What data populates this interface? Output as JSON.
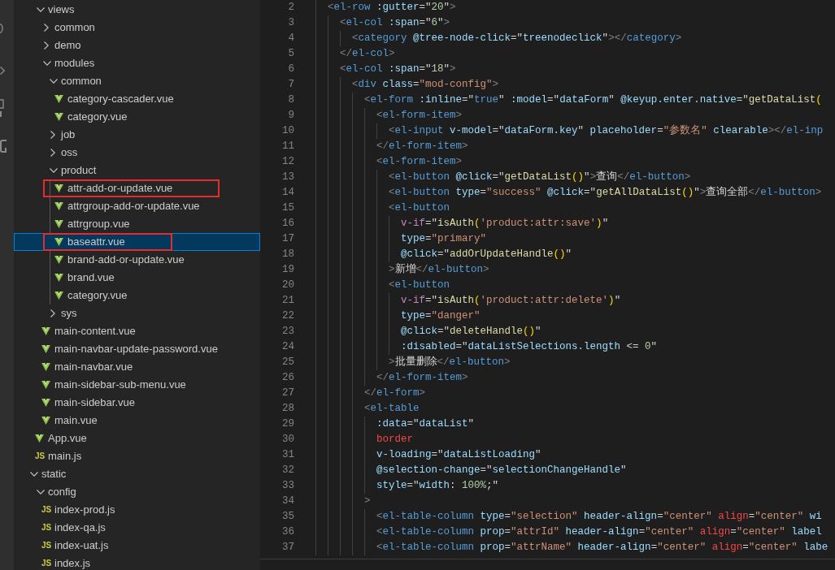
{
  "explorer": {
    "nodes": [
      {
        "children": [
          {
            "label": "views",
            "kind": "folder",
            "expanded": true,
            "selected": false,
            "children": [
              {
                "label": "common",
                "kind": "folder",
                "expanded": false,
                "selected": false
              },
              {
                "label": "demo",
                "kind": "folder",
                "expanded": false,
                "selected": false
              },
              {
                "label": "modules",
                "kind": "folder",
                "expanded": true,
                "selected": false,
                "children": [
                  {
                    "label": "common",
                    "kind": "folder",
                    "expanded": true,
                    "selected": false,
                    "children": [
                      {
                        "label": "category-cascader.vue",
                        "kind": "vue",
                        "selected": false
                      },
                      {
                        "label": "category.vue",
                        "kind": "vue",
                        "selected": false
                      }
                    ]
                  },
                  {
                    "label": "job",
                    "kind": "folder",
                    "expanded": false,
                    "selected": false
                  },
                  {
                    "label": "oss",
                    "kind": "folder",
                    "expanded": false,
                    "selected": false
                  },
                  {
                    "label": "product",
                    "kind": "folder",
                    "expanded": true,
                    "selected": false,
                    "children": [
                      {
                        "label": "attr-add-or-update.vue",
                        "kind": "vue",
                        "selected": false,
                        "annotated": true
                      },
                      {
                        "label": "attrgroup-add-or-update.vue",
                        "kind": "vue",
                        "selected": false,
                        "annotated": false
                      },
                      {
                        "label": "attrgroup.vue",
                        "kind": "vue",
                        "selected": false,
                        "annotated": false
                      },
                      {
                        "label": "baseattr.vue",
                        "kind": "vue",
                        "selected": true,
                        "annotated": true
                      },
                      {
                        "label": "brand-add-or-update.vue",
                        "kind": "vue",
                        "selected": false,
                        "annotated": false
                      },
                      {
                        "label": "brand.vue",
                        "kind": "vue",
                        "selected": false,
                        "annotated": false
                      },
                      {
                        "label": "category.vue",
                        "kind": "vue",
                        "selected": false,
                        "annotated": false
                      }
                    ]
                  },
                  {
                    "label": "sys",
                    "kind": "folder",
                    "expanded": false,
                    "selected": false
                  }
                ]
              },
              {
                "label": "main-content.vue",
                "kind": "vue",
                "selected": false
              },
              {
                "label": "main-navbar-update-password.vue",
                "kind": "vue",
                "selected": false
              },
              {
                "label": "main-navbar.vue",
                "kind": "vue",
                "selected": false
              },
              {
                "label": "main-sidebar-sub-menu.vue",
                "kind": "vue",
                "selected": false
              },
              {
                "label": "main-sidebar.vue",
                "kind": "vue",
                "selected": false
              },
              {
                "label": "main.vue",
                "kind": "vue",
                "selected": false
              }
            ]
          },
          {
            "label": "App.vue",
            "kind": "vue",
            "selected": false
          },
          {
            "label": "main.js",
            "kind": "js",
            "icon_text": "JS",
            "selected": false
          }
        ]
      },
      {
        "label": "static",
        "kind": "folder",
        "expanded": true,
        "selected": false,
        "children": [
          {
            "label": "config",
            "kind": "folder",
            "expanded": true,
            "selected": false,
            "children": [
              {
                "label": "index-prod.js",
                "kind": "js",
                "icon_text": "JS",
                "selected": false
              },
              {
                "label": "index-qa.js",
                "kind": "js",
                "icon_text": "JS",
                "selected": false
              },
              {
                "label": "index-uat.js",
                "kind": "js",
                "icon_text": "JS",
                "selected": false
              },
              {
                "label": "index.js",
                "kind": "js",
                "icon_text": "JS",
                "selected": false
              }
            ]
          }
        ]
      }
    ]
  },
  "editor": {
    "lines": [
      {
        "number": "2",
        "tokens": [
          {
            "text": "  <",
            "kind": "bracket"
          },
          {
            "text": "el-row",
            "kind": "tag"
          },
          {
            "text": " :gutter",
            "kind": "attr"
          },
          {
            "text": "=\"",
            "kind": "plain"
          },
          {
            "text": "20",
            "kind": "number"
          },
          {
            "text": "\"",
            "kind": "plain"
          },
          {
            "text": ">",
            "kind": "bracket"
          }
        ]
      },
      {
        "number": "3",
        "tokens": [
          {
            "text": "    <",
            "kind": "bracket"
          },
          {
            "text": "el-col",
            "kind": "tag"
          },
          {
            "text": " :span",
            "kind": "attr"
          },
          {
            "text": "=\"",
            "kind": "plain"
          },
          {
            "text": "6",
            "kind": "number"
          },
          {
            "text": "\"",
            "kind": "plain"
          },
          {
            "text": ">",
            "kind": "bracket"
          }
        ]
      },
      {
        "number": "4",
        "tokens": [
          {
            "text": "      <",
            "kind": "bracket"
          },
          {
            "text": "category",
            "kind": "tag"
          },
          {
            "text": " @tree-node-click",
            "kind": "attr"
          },
          {
            "text": "=\"",
            "kind": "plain"
          },
          {
            "text": "treenodeclick",
            "kind": "attr"
          },
          {
            "text": "\"",
            "kind": "plain"
          },
          {
            "text": "></",
            "kind": "bracket"
          },
          {
            "text": "category",
            "kind": "tag"
          },
          {
            "text": ">",
            "kind": "bracket"
          }
        ]
      },
      {
        "number": "5",
        "tokens": [
          {
            "text": "    </",
            "kind": "bracket"
          },
          {
            "text": "el-col",
            "kind": "tag"
          },
          {
            "text": ">",
            "kind": "bracket"
          }
        ]
      },
      {
        "number": "6",
        "tokens": [
          {
            "text": "    <",
            "kind": "bracket"
          },
          {
            "text": "el-col",
            "kind": "tag"
          },
          {
            "text": " :span",
            "kind": "attr"
          },
          {
            "text": "=\"",
            "kind": "plain"
          },
          {
            "text": "18",
            "kind": "number"
          },
          {
            "text": "\"",
            "kind": "plain"
          },
          {
            "text": ">",
            "kind": "bracket"
          }
        ]
      },
      {
        "number": "7",
        "tokens": [
          {
            "text": "      <",
            "kind": "bracket"
          },
          {
            "text": "div",
            "kind": "tag"
          },
          {
            "text": " class",
            "kind": "attr"
          },
          {
            "text": "=",
            "kind": "plain"
          },
          {
            "text": "\"mod-config\"",
            "kind": "string"
          },
          {
            "text": ">",
            "kind": "bracket"
          }
        ]
      },
      {
        "number": "8",
        "tokens": [
          {
            "text": "        <",
            "kind": "bracket"
          },
          {
            "text": "el-form",
            "kind": "tag"
          },
          {
            "text": " :inline",
            "kind": "attr"
          },
          {
            "text": "=\"",
            "kind": "plain"
          },
          {
            "text": "true",
            "kind": "keyword"
          },
          {
            "text": "\" ",
            "kind": "plain"
          },
          {
            "text": ":model",
            "kind": "attr"
          },
          {
            "text": "=\"",
            "kind": "plain"
          },
          {
            "text": "dataForm",
            "kind": "attr"
          },
          {
            "text": "\" ",
            "kind": "plain"
          },
          {
            "text": "@keyup.enter.native",
            "kind": "attr"
          },
          {
            "text": "=\"",
            "kind": "plain"
          },
          {
            "text": "getDataList",
            "kind": "func"
          },
          {
            "text": "(",
            "kind": "paren"
          }
        ]
      },
      {
        "number": "9",
        "tokens": [
          {
            "text": "          <",
            "kind": "bracket"
          },
          {
            "text": "el-form-item",
            "kind": "tag"
          },
          {
            "text": ">",
            "kind": "bracket"
          }
        ]
      },
      {
        "number": "10",
        "tokens": [
          {
            "text": "            <",
            "kind": "bracket"
          },
          {
            "text": "el-input",
            "kind": "tag"
          },
          {
            "text": " v-model",
            "kind": "attr"
          },
          {
            "text": "=\"",
            "kind": "plain"
          },
          {
            "text": "dataForm.key",
            "kind": "attr"
          },
          {
            "text": "\" ",
            "kind": "plain"
          },
          {
            "text": "placeholder",
            "kind": "attr"
          },
          {
            "text": "=",
            "kind": "plain"
          },
          {
            "text": "\"参数名\"",
            "kind": "string"
          },
          {
            "text": " clearable",
            "kind": "attr"
          },
          {
            "text": "></",
            "kind": "bracket"
          },
          {
            "text": "el-inp",
            "kind": "tag"
          }
        ]
      },
      {
        "number": "11",
        "tokens": [
          {
            "text": "          </",
            "kind": "bracket"
          },
          {
            "text": "el-form-item",
            "kind": "tag"
          },
          {
            "text": ">",
            "kind": "bracket"
          }
        ]
      },
      {
        "number": "12",
        "tokens": [
          {
            "text": "          <",
            "kind": "bracket"
          },
          {
            "text": "el-form-item",
            "kind": "tag"
          },
          {
            "text": ">",
            "kind": "bracket"
          }
        ]
      },
      {
        "number": "13",
        "tokens": [
          {
            "text": "            <",
            "kind": "bracket"
          },
          {
            "text": "el-button",
            "kind": "tag"
          },
          {
            "text": " @click",
            "kind": "attr"
          },
          {
            "text": "=\"",
            "kind": "plain"
          },
          {
            "text": "getDataList",
            "kind": "func"
          },
          {
            "text": "()",
            "kind": "paren"
          },
          {
            "text": "\"",
            "kind": "plain"
          },
          {
            "text": ">",
            "kind": "bracket"
          },
          {
            "text": "查询",
            "kind": "plain"
          },
          {
            "text": "</",
            "kind": "bracket"
          },
          {
            "text": "el-button",
            "kind": "tag"
          },
          {
            "text": ">",
            "kind": "bracket"
          }
        ]
      },
      {
        "number": "14",
        "tokens": [
          {
            "text": "            <",
            "kind": "bracket"
          },
          {
            "text": "el-button",
            "kind": "tag"
          },
          {
            "text": " type",
            "kind": "attr"
          },
          {
            "text": "=",
            "kind": "plain"
          },
          {
            "text": "\"success\"",
            "kind": "string"
          },
          {
            "text": " @click",
            "kind": "attr"
          },
          {
            "text": "=\"",
            "kind": "plain"
          },
          {
            "text": "getAllDataList",
            "kind": "func"
          },
          {
            "text": "()",
            "kind": "paren"
          },
          {
            "text": "\"",
            "kind": "plain"
          },
          {
            "text": ">",
            "kind": "bracket"
          },
          {
            "text": "查询全部",
            "kind": "plain"
          },
          {
            "text": "</",
            "kind": "bracket"
          },
          {
            "text": "el-button",
            "kind": "tag"
          },
          {
            "text": ">",
            "kind": "bracket"
          }
        ]
      },
      {
        "number": "15",
        "tokens": [
          {
            "text": "            <",
            "kind": "bracket"
          },
          {
            "text": "el-button",
            "kind": "tag"
          }
        ]
      },
      {
        "number": "16",
        "tokens": [
          {
            "text": "              v-if",
            "kind": "directive"
          },
          {
            "text": "=\"",
            "kind": "plain"
          },
          {
            "text": "isAuth",
            "kind": "func"
          },
          {
            "text": "(",
            "kind": "paren"
          },
          {
            "text": "'product:attr:save'",
            "kind": "string"
          },
          {
            "text": ")",
            "kind": "paren"
          },
          {
            "text": "\"",
            "kind": "plain"
          }
        ]
      },
      {
        "number": "17",
        "tokens": [
          {
            "text": "              type",
            "kind": "attr"
          },
          {
            "text": "=",
            "kind": "plain"
          },
          {
            "text": "\"primary\"",
            "kind": "string"
          }
        ]
      },
      {
        "number": "18",
        "tokens": [
          {
            "text": "              @click",
            "kind": "attr"
          },
          {
            "text": "=\"",
            "kind": "plain"
          },
          {
            "text": "addOrUpdateHandle",
            "kind": "func"
          },
          {
            "text": "()",
            "kind": "paren"
          },
          {
            "text": "\"",
            "kind": "plain"
          }
        ]
      },
      {
        "number": "19",
        "tokens": [
          {
            "text": "            >",
            "kind": "bracket"
          },
          {
            "text": "新增",
            "kind": "plain"
          },
          {
            "text": "</",
            "kind": "bracket"
          },
          {
            "text": "el-button",
            "kind": "tag"
          },
          {
            "text": ">",
            "kind": "bracket"
          }
        ]
      },
      {
        "number": "20",
        "tokens": [
          {
            "text": "            <",
            "kind": "bracket"
          },
          {
            "text": "el-button",
            "kind": "tag"
          }
        ]
      },
      {
        "number": "21",
        "tokens": [
          {
            "text": "              v-if",
            "kind": "directive"
          },
          {
            "text": "=\"",
            "kind": "plain"
          },
          {
            "text": "isAuth",
            "kind": "func"
          },
          {
            "text": "(",
            "kind": "paren"
          },
          {
            "text": "'product:attr:delete'",
            "kind": "string"
          },
          {
            "text": ")",
            "kind": "paren"
          },
          {
            "text": "\"",
            "kind": "plain"
          }
        ]
      },
      {
        "number": "22",
        "tokens": [
          {
            "text": "              type",
            "kind": "attr"
          },
          {
            "text": "=",
            "kind": "plain"
          },
          {
            "text": "\"danger\"",
            "kind": "string"
          }
        ]
      },
      {
        "number": "23",
        "tokens": [
          {
            "text": "              @click",
            "kind": "attr"
          },
          {
            "text": "=\"",
            "kind": "plain"
          },
          {
            "text": "deleteHandle",
            "kind": "func"
          },
          {
            "text": "()",
            "kind": "paren"
          },
          {
            "text": "\"",
            "kind": "plain"
          }
        ]
      },
      {
        "number": "24",
        "tokens": [
          {
            "text": "              :disabled",
            "kind": "attr"
          },
          {
            "text": "=\"",
            "kind": "plain"
          },
          {
            "text": "dataListSelections.length",
            "kind": "attr"
          },
          {
            "text": " <= ",
            "kind": "plain"
          },
          {
            "text": "0",
            "kind": "number"
          },
          {
            "text": "\"",
            "kind": "plain"
          }
        ]
      },
      {
        "number": "25",
        "tokens": [
          {
            "text": "            >",
            "kind": "bracket"
          },
          {
            "text": "批量删除",
            "kind": "plain"
          },
          {
            "text": "</",
            "kind": "bracket"
          },
          {
            "text": "el-button",
            "kind": "tag"
          },
          {
            "text": ">",
            "kind": "bracket"
          }
        ]
      },
      {
        "number": "26",
        "tokens": [
          {
            "text": "          </",
            "kind": "bracket"
          },
          {
            "text": "el-form-item",
            "kind": "tag"
          },
          {
            "text": ">",
            "kind": "bracket"
          }
        ]
      },
      {
        "number": "27",
        "tokens": [
          {
            "text": "        </",
            "kind": "bracket"
          },
          {
            "text": "el-form",
            "kind": "tag"
          },
          {
            "text": ">",
            "kind": "bracket"
          }
        ]
      },
      {
        "number": "28",
        "tokens": [
          {
            "text": "        <",
            "kind": "bracket"
          },
          {
            "text": "el-table",
            "kind": "tag"
          }
        ]
      },
      {
        "number": "29",
        "tokens": [
          {
            "text": "          :data",
            "kind": "attr"
          },
          {
            "text": "=\"",
            "kind": "plain"
          },
          {
            "text": "dataList",
            "kind": "attr"
          },
          {
            "text": "\"",
            "kind": "plain"
          }
        ]
      },
      {
        "number": "30",
        "tokens": [
          {
            "text": "          border",
            "kind": "error"
          }
        ]
      },
      {
        "number": "31",
        "tokens": [
          {
            "text": "          v-loading",
            "kind": "attr"
          },
          {
            "text": "=\"",
            "kind": "plain"
          },
          {
            "text": "dataListLoading",
            "kind": "attr"
          },
          {
            "text": "\"",
            "kind": "plain"
          }
        ]
      },
      {
        "number": "32",
        "tokens": [
          {
            "text": "          @selection-change",
            "kind": "attr"
          },
          {
            "text": "=\"",
            "kind": "plain"
          },
          {
            "text": "selectionChangeHandle",
            "kind": "attr"
          },
          {
            "text": "\"",
            "kind": "plain"
          }
        ]
      },
      {
        "number": "33",
        "tokens": [
          {
            "text": "          style",
            "kind": "attr"
          },
          {
            "text": "=\"",
            "kind": "plain"
          },
          {
            "text": "width",
            "kind": "attr"
          },
          {
            "text": ": ",
            "kind": "plain"
          },
          {
            "text": "100%",
            "kind": "number"
          },
          {
            "text": ";\"",
            "kind": "plain"
          }
        ]
      },
      {
        "number": "34",
        "tokens": [
          {
            "text": "        >",
            "kind": "bracket"
          }
        ]
      },
      {
        "number": "35",
        "tokens": [
          {
            "text": "          <",
            "kind": "bracket"
          },
          {
            "text": "el-table-column",
            "kind": "tag"
          },
          {
            "text": " type",
            "kind": "attr"
          },
          {
            "text": "=",
            "kind": "plain"
          },
          {
            "text": "\"selection\"",
            "kind": "string"
          },
          {
            "text": " header-align",
            "kind": "attr"
          },
          {
            "text": "=",
            "kind": "plain"
          },
          {
            "text": "\"center\"",
            "kind": "string"
          },
          {
            "text": " align",
            "kind": "error"
          },
          {
            "text": "=",
            "kind": "plain"
          },
          {
            "text": "\"center\"",
            "kind": "string"
          },
          {
            "text": " wi",
            "kind": "attr"
          }
        ]
      },
      {
        "number": "36",
        "tokens": [
          {
            "text": "          <",
            "kind": "bracket"
          },
          {
            "text": "el-table-column",
            "kind": "tag"
          },
          {
            "text": " prop",
            "kind": "attr"
          },
          {
            "text": "=",
            "kind": "plain"
          },
          {
            "text": "\"attrId\"",
            "kind": "string"
          },
          {
            "text": " header-align",
            "kind": "attr"
          },
          {
            "text": "=",
            "kind": "plain"
          },
          {
            "text": "\"center\"",
            "kind": "string"
          },
          {
            "text": " align",
            "kind": "error"
          },
          {
            "text": "=",
            "kind": "plain"
          },
          {
            "text": "\"center\"",
            "kind": "string"
          },
          {
            "text": " label",
            "kind": "attr"
          }
        ]
      },
      {
        "number": "37",
        "tokens": [
          {
            "text": "          <",
            "kind": "bracket"
          },
          {
            "text": "el-table-column",
            "kind": "tag"
          },
          {
            "text": " prop",
            "kind": "attr"
          },
          {
            "text": "=",
            "kind": "plain"
          },
          {
            "text": "\"attrName\"",
            "kind": "string"
          },
          {
            "text": " header-align",
            "kind": "attr"
          },
          {
            "text": "=",
            "kind": "plain"
          },
          {
            "text": "\"center\"",
            "kind": "string"
          },
          {
            "text": " align",
            "kind": "error"
          },
          {
            "text": "=",
            "kind": "plain"
          },
          {
            "text": "\"center\"",
            "kind": "string"
          },
          {
            "text": " labe",
            "kind": "attr"
          }
        ]
      }
    ]
  }
}
